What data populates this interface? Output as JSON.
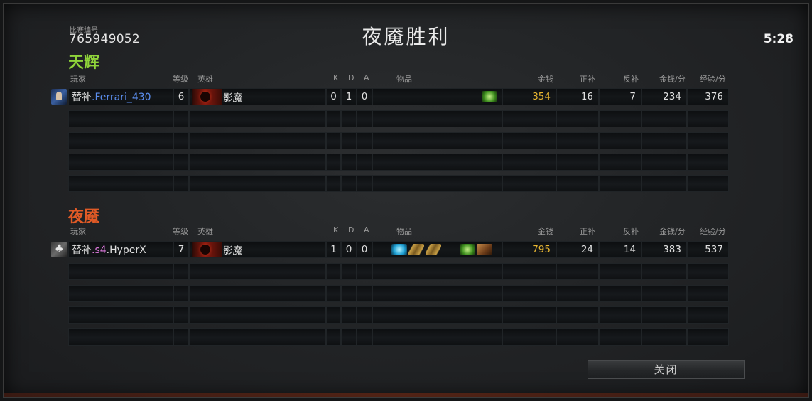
{
  "match": {
    "id_label": "比赛编号",
    "id": "765949052",
    "result_title": "夜魇胜利",
    "duration": "5:28"
  },
  "headers": {
    "player": "玩家",
    "level": "等级",
    "hero": "英雄",
    "k": "K",
    "d": "D",
    "a": "A",
    "items": "物品",
    "gold": "金钱",
    "last_hits": "正补",
    "denies": "反补",
    "gpm": "金钱/分",
    "xpm": "经验/分"
  },
  "teams": {
    "radiant": {
      "name": "天辉",
      "color": "#8fd43a",
      "players": [
        {
          "name_prefix": "替补",
          "name_tag": ".Ferrari_430",
          "name_tag_color": "#5b8eef",
          "level": "6",
          "hero": "影魔",
          "k": "0",
          "d": "1",
          "a": "0",
          "items": [
            "wraith-band-icon"
          ],
          "gold": "354",
          "last_hits": "16",
          "denies": "7",
          "gpm": "234",
          "xpm": "376"
        }
      ]
    },
    "dire": {
      "name": "夜魇",
      "color": "#e05a26",
      "players": [
        {
          "name_prefix": "替补",
          "name_tag": ".s4",
          "name_suffix": ".HyperX",
          "name_tag_color": "#e07ae0",
          "level": "7",
          "hero": "影魔",
          "k": "1",
          "d": "0",
          "a": "0",
          "items": [
            "tango-icon",
            "iron-branch-icon",
            "iron-branch-icon",
            "wraith-band-icon",
            "boots-icon"
          ],
          "gold": "795",
          "last_hits": "24",
          "denies": "14",
          "gpm": "383",
          "xpm": "537"
        }
      ]
    }
  },
  "close_button": "关闭",
  "colors": {
    "gold": "#e8b631",
    "background": "#232527"
  }
}
